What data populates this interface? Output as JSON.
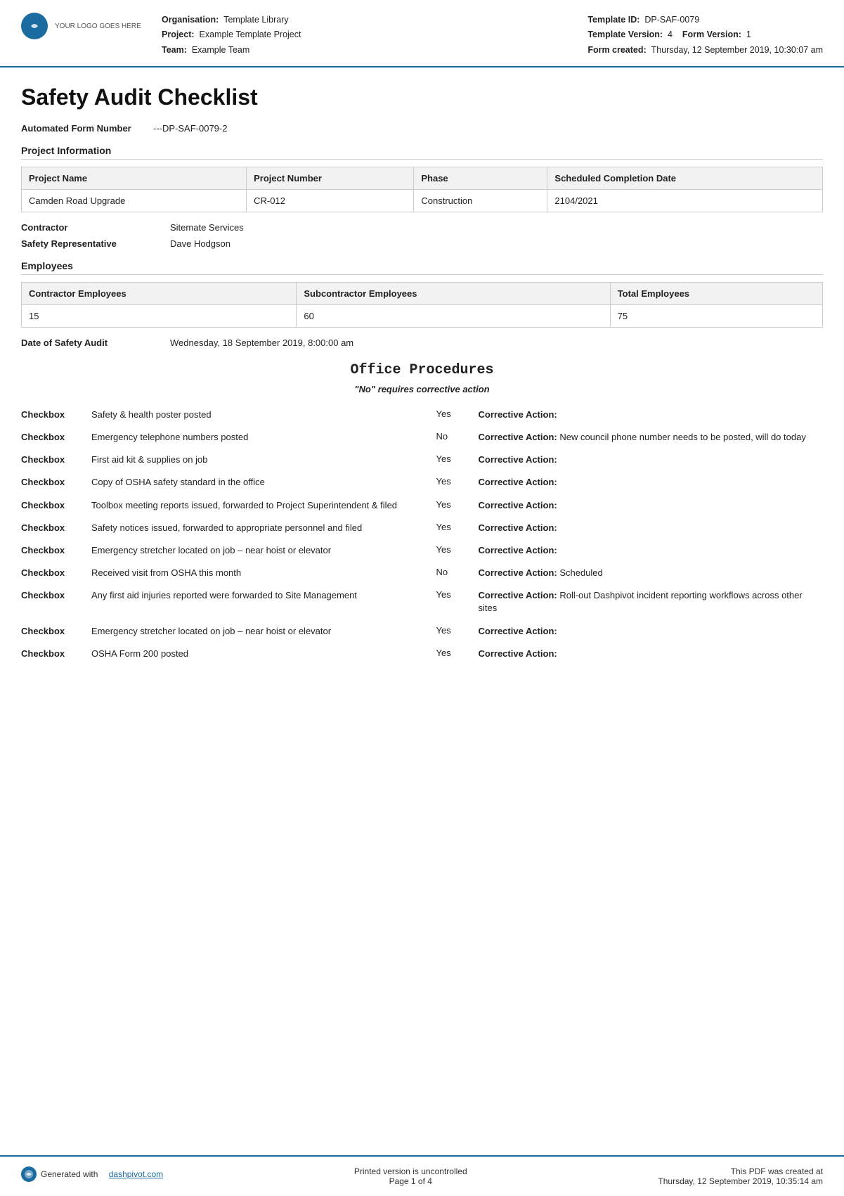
{
  "header": {
    "logo_text": "YOUR LOGO GOES HERE",
    "org_label": "Organisation:",
    "org_value": "Template Library",
    "project_label": "Project:",
    "project_value": "Example Template Project",
    "team_label": "Team:",
    "team_value": "Example Team",
    "template_id_label": "Template ID:",
    "template_id_value": "DP-SAF-0079",
    "template_version_label": "Template Version:",
    "template_version_value": "4",
    "form_version_label": "Form Version:",
    "form_version_value": "1",
    "form_created_label": "Form created:",
    "form_created_value": "Thursday, 12 September 2019, 10:30:07 am"
  },
  "page_title": "Safety Audit Checklist",
  "automated_form_number_label": "Automated Form Number",
  "automated_form_number_value": "---DP-SAF-0079-2",
  "section_project_info": "Project Information",
  "project_table": {
    "headers": [
      "Project Name",
      "Project Number",
      "Phase",
      "Scheduled Completion Date"
    ],
    "row": [
      "Camden Road Upgrade",
      "CR-012",
      "Construction",
      "2104/2021"
    ]
  },
  "contractor_label": "Contractor",
  "contractor_value": "Sitemate Services",
  "safety_rep_label": "Safety Representative",
  "safety_rep_value": "Dave Hodgson",
  "employees_section": "Employees",
  "employees_table": {
    "headers": [
      "Contractor Employees",
      "Subcontractor Employees",
      "Total Employees"
    ],
    "row": [
      "15",
      "60",
      "75"
    ]
  },
  "date_of_audit_label": "Date of Safety Audit",
  "date_of_audit_value": "Wednesday, 18 September 2019, 8:00:00 am",
  "office_procedures_title": "Office Procedures",
  "no_requires_note": "\"No\" requires corrective action",
  "checklist_items": [
    {
      "checkbox_label": "Checkbox",
      "description": "Safety & health poster posted",
      "answer": "Yes",
      "corrective_label": "Corrective Action:",
      "corrective_value": ""
    },
    {
      "checkbox_label": "Checkbox",
      "description": "Emergency telephone numbers posted",
      "answer": "No",
      "corrective_label": "Corrective Action:",
      "corrective_value": "New council phone number needs to be posted, will do today"
    },
    {
      "checkbox_label": "Checkbox",
      "description": "First aid kit & supplies on job",
      "answer": "Yes",
      "corrective_label": "Corrective Action:",
      "corrective_value": ""
    },
    {
      "checkbox_label": "Checkbox",
      "description": "Copy of OSHA safety standard in the office",
      "answer": "Yes",
      "corrective_label": "Corrective Action:",
      "corrective_value": ""
    },
    {
      "checkbox_label": "Checkbox",
      "description": "Toolbox meeting reports issued, forwarded to Project Superintendent & filed",
      "answer": "Yes",
      "corrective_label": "Corrective Action:",
      "corrective_value": ""
    },
    {
      "checkbox_label": "Checkbox",
      "description": "Safety notices issued, forwarded to appropriate personnel and filed",
      "answer": "Yes",
      "corrective_label": "Corrective Action:",
      "corrective_value": ""
    },
    {
      "checkbox_label": "Checkbox",
      "description": "Emergency stretcher located on job – near hoist or elevator",
      "answer": "Yes",
      "corrective_label": "Corrective Action:",
      "corrective_value": ""
    },
    {
      "checkbox_label": "Checkbox",
      "description": "Received visit from OSHA this month",
      "answer": "No",
      "corrective_label": "Corrective Action:",
      "corrective_value": "Scheduled"
    },
    {
      "checkbox_label": "Checkbox",
      "description": "Any first aid injuries reported were forwarded to Site Management",
      "answer": "Yes",
      "corrective_label": "Corrective Action:",
      "corrective_value": "Roll-out Dashpivot incident reporting workflows across other sites"
    },
    {
      "checkbox_label": "Checkbox",
      "description": "Emergency stretcher located on job – near hoist or elevator",
      "answer": "Yes",
      "corrective_label": "Corrective Action:",
      "corrective_value": ""
    },
    {
      "checkbox_label": "Checkbox",
      "description": "OSHA Form 200 posted",
      "answer": "Yes",
      "corrective_label": "Corrective Action:",
      "corrective_value": ""
    }
  ],
  "footer": {
    "generated_with": "Generated with",
    "footer_link_text": "dashpivot.com",
    "printed_version": "Printed version is uncontrolled",
    "page_info": "Page 1 of 4",
    "pdf_created_label": "This PDF was created at",
    "pdf_created_value": "Thursday, 12 September 2019, 10:35:14 am"
  }
}
